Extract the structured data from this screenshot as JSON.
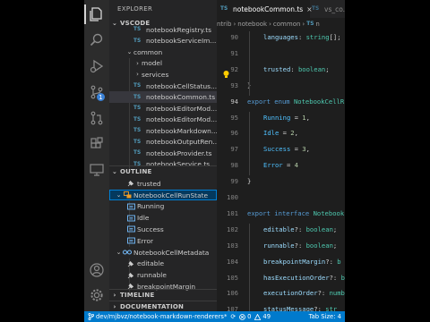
{
  "activity": {
    "scm_badge": "1"
  },
  "sidebar": {
    "title": "EXPLORER",
    "workspace": "VSCODE",
    "files": [
      {
        "name": "notebookRegistry.ts",
        "kind": "ts"
      },
      {
        "name": "notebookServiceIm...",
        "kind": "ts"
      },
      {
        "name": "common",
        "kind": "folder-open"
      },
      {
        "name": "model",
        "kind": "folder"
      },
      {
        "name": "services",
        "kind": "folder"
      },
      {
        "name": "notebookCellStatus...",
        "kind": "ts"
      },
      {
        "name": "notebookCommon.ts",
        "kind": "ts"
      },
      {
        "name": "notebookEditorMod...",
        "kind": "ts"
      },
      {
        "name": "notebookEditorMod...",
        "kind": "ts"
      },
      {
        "name": "notebookMarkdown...",
        "kind": "ts"
      },
      {
        "name": "notebookOutputRen...",
        "kind": "ts"
      },
      {
        "name": "notebookProvider.ts",
        "kind": "ts"
      },
      {
        "name": "notebookService.ts",
        "kind": "ts"
      }
    ],
    "outline_title": "OUTLINE",
    "outline": [
      {
        "name": "trusted",
        "level": 1,
        "kind": "prop"
      },
      {
        "name": "NotebookCellRunState",
        "level": 0,
        "kind": "enum"
      },
      {
        "name": "Running",
        "level": 1,
        "kind": "member"
      },
      {
        "name": "Idle",
        "level": 1,
        "kind": "member"
      },
      {
        "name": "Success",
        "level": 1,
        "kind": "member"
      },
      {
        "name": "Error",
        "level": 1,
        "kind": "member"
      },
      {
        "name": "NotebookCellMetadata",
        "level": 0,
        "kind": "iface"
      },
      {
        "name": "editable",
        "level": 1,
        "kind": "prop"
      },
      {
        "name": "runnable",
        "level": 1,
        "kind": "prop"
      },
      {
        "name": "breakpointMargin",
        "level": 1,
        "kind": "prop"
      }
    ],
    "timeline_title": "TIMELINE",
    "documentation_title": "DOCUMENTATION"
  },
  "tabs": [
    {
      "icon": "TS",
      "label": "notebookCommon.ts",
      "close": "×"
    },
    {
      "icon": "TS",
      "label": "vs_co..."
    }
  ],
  "breadcrumb": [
    "ntrib",
    "notebook",
    "common",
    "TS",
    "n"
  ],
  "code_lines": [
    {
      "num": "90",
      "indent": 1,
      "tokens": [
        {
          "t": "languages",
          "c": "prop"
        },
        {
          "t": ": "
        },
        {
          "t": "string",
          "c": "ty"
        },
        {
          "t": "[];"
        }
      ]
    },
    {
      "num": "91",
      "indent": 0,
      "tokens": []
    },
    {
      "num": "92",
      "indent": 1,
      "tokens": [
        {
          "t": "trusted",
          "c": "prop"
        },
        {
          "t": ": "
        },
        {
          "t": "boolean",
          "c": "ty"
        },
        {
          "t": ";"
        }
      ]
    },
    {
      "num": "93",
      "indent": 0,
      "tokens": [
        {
          "t": "}"
        }
      ]
    },
    {
      "num": "94",
      "indent": 0,
      "tokens": [
        {
          "t": "export ",
          "c": "kw"
        },
        {
          "t": "enum ",
          "c": "kw"
        },
        {
          "t": "NotebookCellR",
          "c": "ty"
        }
      ]
    },
    {
      "num": "95",
      "indent": 1,
      "tokens": [
        {
          "t": "Running",
          "c": "en"
        },
        {
          "t": " = "
        },
        {
          "t": "1",
          "c": "num"
        },
        {
          "t": ","
        }
      ]
    },
    {
      "num": "96",
      "indent": 1,
      "tokens": [
        {
          "t": "Idle",
          "c": "en"
        },
        {
          "t": " = "
        },
        {
          "t": "2",
          "c": "num"
        },
        {
          "t": ","
        }
      ]
    },
    {
      "num": "97",
      "indent": 1,
      "tokens": [
        {
          "t": "Success",
          "c": "en"
        },
        {
          "t": " = "
        },
        {
          "t": "3",
          "c": "num"
        },
        {
          "t": ","
        }
      ]
    },
    {
      "num": "98",
      "indent": 1,
      "tokens": [
        {
          "t": "Error",
          "c": "en"
        },
        {
          "t": " = "
        },
        {
          "t": "4",
          "c": "num"
        }
      ]
    },
    {
      "num": "99",
      "indent": 0,
      "tokens": [
        {
          "t": "}"
        }
      ]
    },
    {
      "num": "100",
      "indent": 0,
      "tokens": []
    },
    {
      "num": "101",
      "indent": 0,
      "tokens": [
        {
          "t": "export ",
          "c": "kw"
        },
        {
          "t": "interface ",
          "c": "kw"
        },
        {
          "t": "Notebook",
          "c": "ty"
        }
      ]
    },
    {
      "num": "102",
      "indent": 1,
      "tokens": [
        {
          "t": "editable",
          "c": "prop"
        },
        {
          "t": "?: "
        },
        {
          "t": "boolean",
          "c": "ty"
        },
        {
          "t": ";"
        }
      ]
    },
    {
      "num": "103",
      "indent": 1,
      "tokens": [
        {
          "t": "runnable",
          "c": "prop"
        },
        {
          "t": "?: "
        },
        {
          "t": "boolean",
          "c": "ty"
        },
        {
          "t": ";"
        }
      ]
    },
    {
      "num": "104",
      "indent": 1,
      "tokens": [
        {
          "t": "breakpointMargin",
          "c": "prop"
        },
        {
          "t": "?: "
        },
        {
          "t": "b",
          "c": "ty"
        }
      ]
    },
    {
      "num": "105",
      "indent": 1,
      "tokens": [
        {
          "t": "hasExecutionOrder",
          "c": "prop"
        },
        {
          "t": "?: "
        },
        {
          "t": "b",
          "c": "ty"
        }
      ]
    },
    {
      "num": "106",
      "indent": 1,
      "tokens": [
        {
          "t": "executionOrder",
          "c": "prop"
        },
        {
          "t": "?: "
        },
        {
          "t": "numb",
          "c": "ty"
        }
      ]
    },
    {
      "num": "107",
      "indent": 1,
      "tokens": [
        {
          "t": "statusMessage",
          "c": "prop"
        },
        {
          "t": "?: "
        },
        {
          "t": "str",
          "c": "ty"
        }
      ]
    }
  ],
  "status": {
    "branch": "dev/mjbvz/notebook-markdown-renderers*",
    "sync": "⟳",
    "errors": "0",
    "warnings": "49",
    "tab_size": "Tab Size: 4"
  },
  "colors": {
    "accent": "#007acc",
    "selection": "#04395e",
    "ts_icon": "#519aba"
  }
}
